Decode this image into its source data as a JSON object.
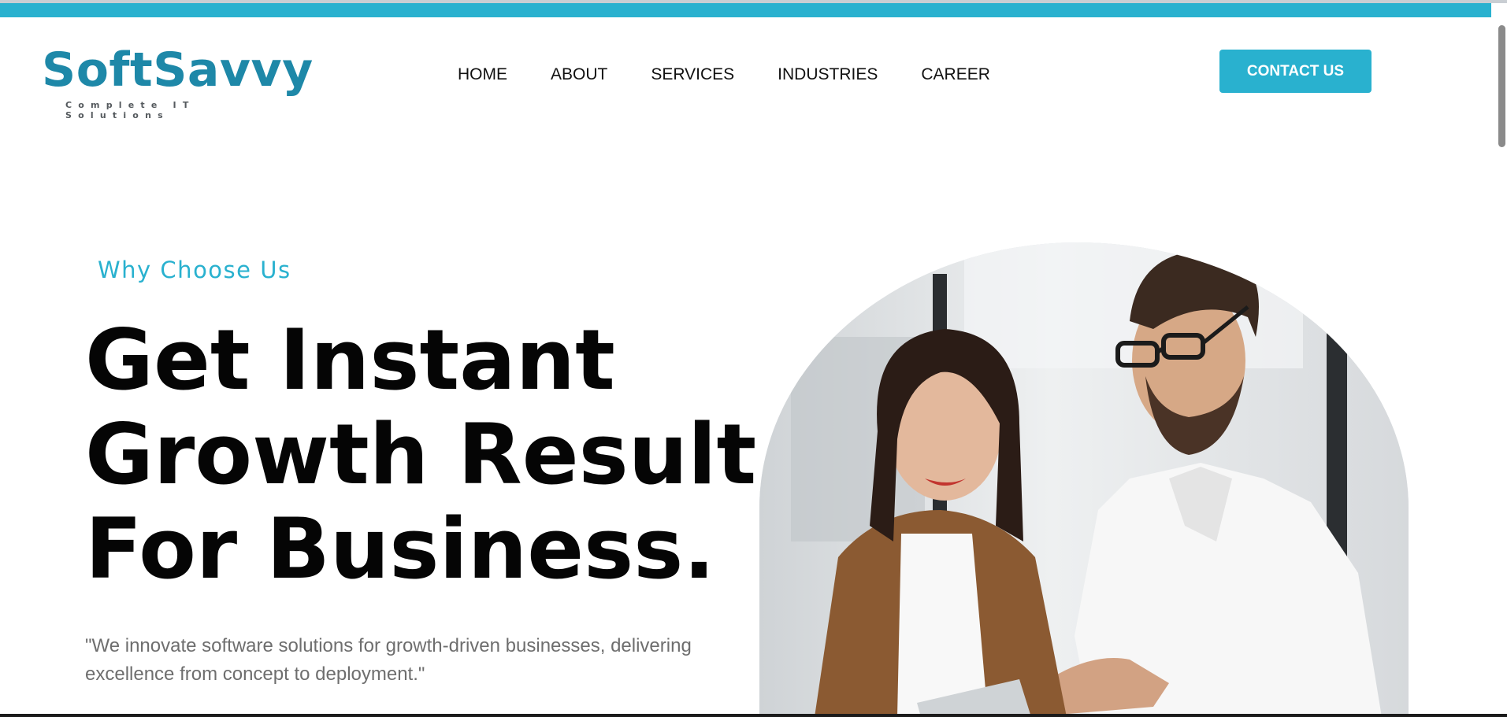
{
  "brand": {
    "name": "SoftSavvy",
    "tagline": "Complete IT Solutions"
  },
  "nav": {
    "items": [
      {
        "label": "HOME"
      },
      {
        "label": "ABOUT"
      },
      {
        "label": "SERVICES"
      },
      {
        "label": "INDUSTRIES"
      },
      {
        "label": "CAREER"
      }
    ]
  },
  "header": {
    "contact_label": "CONTACT US"
  },
  "hero": {
    "eyebrow": "Why Choose Us",
    "headline": [
      "Get Instant",
      "Growth Result",
      "For Business."
    ],
    "lead": "\"We innovate software solutions for growth-driven businesses, delivering excellence from concept to deployment.\""
  },
  "colors": {
    "accent": "#29b1cf",
    "logo": "#1e88a8",
    "heading": "#050505",
    "body_text": "#6e6e6e"
  }
}
